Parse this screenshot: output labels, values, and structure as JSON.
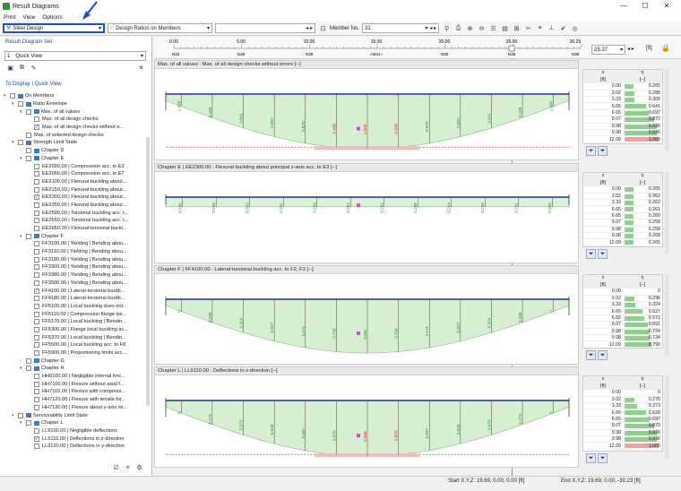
{
  "window": {
    "title": "Result Diagrams"
  },
  "menu": [
    "Print",
    "View",
    "Options"
  ],
  "toolbar": {
    "design_combo": "Steel Design",
    "ratio_combo": "Design Ratios on Members",
    "member_label": "Member No.",
    "member_value": "31"
  },
  "sidebar": {
    "set_title": "Result Diagram Set",
    "set_number": "1",
    "set_name": "Quick View",
    "display_title": "To Display | Quick View",
    "tree": [
      {
        "l": 0,
        "e": "▾",
        "c": "",
        "t": "On Members"
      },
      {
        "l": 1,
        "e": "▾",
        "c": "",
        "t": "Ratio Envelope"
      },
      {
        "l": 2,
        "e": "▾",
        "c": "",
        "t": "Max. of all values"
      },
      {
        "l": 3,
        "e": "",
        "c": "",
        "t": "Max. of all design checks"
      },
      {
        "l": 3,
        "e": "",
        "c": "✓",
        "t": "Max. of all design checks without e..."
      },
      {
        "l": 2,
        "e": "",
        "c": "",
        "t": "Max. of selected design checks"
      },
      {
        "l": 1,
        "e": "▾",
        "c": "",
        "t": "Strength Limit State"
      },
      {
        "l": 2,
        "e": "›",
        "c": "",
        "t": "Chapter D"
      },
      {
        "l": 2,
        "e": "▾",
        "c": "",
        "t": "Chapter E"
      },
      {
        "l": 3,
        "e": "",
        "c": "",
        "t": "EE2000.00 | Compression acc. to E3"
      },
      {
        "l": 3,
        "e": "",
        "c": "",
        "t": "EE2050.00 | Compression acc. to E7"
      },
      {
        "l": 3,
        "e": "",
        "c": "",
        "t": "EE2100.00 | Flexural buckling about..."
      },
      {
        "l": 3,
        "e": "",
        "c": "",
        "t": "EE2150.00 | Flexural buckling about..."
      },
      {
        "l": 3,
        "e": "",
        "c": "✓",
        "t": "EE2300.00 | Flexural buckling about..."
      },
      {
        "l": 3,
        "e": "",
        "c": "",
        "t": "EE2350.00 | Flexural buckling about..."
      },
      {
        "l": 3,
        "e": "",
        "c": "",
        "t": "EE2500.00 | Torsional buckling acc. t..."
      },
      {
        "l": 3,
        "e": "",
        "c": "",
        "t": "EE2550.00 | Torsional buckling acc. t..."
      },
      {
        "l": 3,
        "e": "",
        "c": "",
        "t": "EE2650.00 | Flexural-torsional buckl..."
      },
      {
        "l": 2,
        "e": "▾",
        "c": "",
        "t": "Chapter F"
      },
      {
        "l": 3,
        "e": "",
        "c": "",
        "t": "FF3100.00 | Yielding | Bending abou..."
      },
      {
        "l": 3,
        "e": "",
        "c": "",
        "t": "FF3110.00 | Yielding | Bending abou..."
      },
      {
        "l": 3,
        "e": "",
        "c": "",
        "t": "FF3180.00 | Yielding | Bending abou..."
      },
      {
        "l": 3,
        "e": "",
        "c": "",
        "t": "FF3300.00 | Yielding | Bending abou..."
      },
      {
        "l": 3,
        "e": "",
        "c": "",
        "t": "FF3380.00 | Yielding | Bending abou..."
      },
      {
        "l": 3,
        "e": "",
        "c": "",
        "t": "FF3500.00 | Yielding | Bending abou..."
      },
      {
        "l": 3,
        "e": "",
        "c": "✓",
        "t": "FF4100.00 | Lateral-torsional buckli..."
      },
      {
        "l": 3,
        "e": "",
        "c": "",
        "t": "FF4180.00 | Lateral-torsional buckli..."
      },
      {
        "l": 3,
        "e": "",
        "c": "",
        "t": "FF5100.00 | Local buckling does not..."
      },
      {
        "l": 3,
        "e": "",
        "c": "",
        "t": "FF5110.00 | Compression flange los..."
      },
      {
        "l": 3,
        "e": "",
        "c": "",
        "t": "FF5170.00 | Local buckling | Bendin..."
      },
      {
        "l": 3,
        "e": "",
        "c": "",
        "t": "FF5300.00 | Flange local buckling ac..."
      },
      {
        "l": 3,
        "e": "",
        "c": "",
        "t": "FF5370.00 | Local buckling | Bendin..."
      },
      {
        "l": 3,
        "e": "",
        "c": "",
        "t": "FF5500.00 | Local buckling acc. to F8"
      },
      {
        "l": 3,
        "e": "",
        "c": "",
        "t": "FF5900.00 | Proportioning limits acc..."
      },
      {
        "l": 2,
        "e": "›",
        "c": "",
        "t": "Chapter G"
      },
      {
        "l": 2,
        "e": "▾",
        "c": "",
        "t": "Chapter H"
      },
      {
        "l": 3,
        "e": "",
        "c": "",
        "t": "HH0100.00 | Negligible internal forc..."
      },
      {
        "l": 3,
        "e": "",
        "c": "",
        "t": "HH7100.00 | Flexure without axial f..."
      },
      {
        "l": 3,
        "e": "",
        "c": "",
        "t": "HH7110.00 | Flexure with compress..."
      },
      {
        "l": 3,
        "e": "",
        "c": "",
        "t": "HH7120.00 | Flexure with tensile for..."
      },
      {
        "l": 3,
        "e": "",
        "c": "",
        "t": "HH7130.00 | Flexure about y-axis wi..."
      },
      {
        "l": 1,
        "e": "▾",
        "c": "",
        "t": "Serviceability Limit State"
      },
      {
        "l": 2,
        "e": "▾",
        "c": "",
        "t": "Chapter L"
      },
      {
        "l": 3,
        "e": "",
        "c": "",
        "t": "LL9100.00 | Negligible deflections"
      },
      {
        "l": 3,
        "e": "",
        "c": "✓",
        "t": "LL9110.00 | Deflections in z-direction"
      },
      {
        "l": 3,
        "e": "",
        "c": "",
        "t": "LL9120.00 | Deflections in y-direction"
      }
    ]
  },
  "ruler": {
    "ticks": [
      "0.00",
      "5.00",
      "10.00",
      "15.00",
      "20.00",
      "25.00",
      "30.25"
    ],
    "nodes": [
      "N33",
      "N38",
      "N38",
      "«M31»",
      "N38",
      "N38",
      "N38"
    ],
    "position_value": "25.37",
    "unit": "[ft]"
  },
  "panels": [
    {
      "title": "Max. of all values : Max. of all design checks without errors [--]",
      "labels": [
        "1.000",
        "0.189",
        "0.641",
        "0.697",
        "0.870",
        "0.936",
        "1.000",
        "0.936",
        "0.870",
        "0.697",
        "0.641",
        "0.189",
        "1.000"
      ],
      "table": {
        "col_x": "x",
        "col_eta": "η",
        "unit_x": "[ft]",
        "unit_eta": "[--]",
        "rows": [
          [
            "0.00",
            "0.265",
            0.27
          ],
          [
            "3.02",
            "0.288",
            0.29
          ],
          [
            "3.33",
            "0.300",
            0.3
          ],
          [
            "6.65",
            "0.641",
            0.64
          ],
          [
            "6.65",
            "0.697",
            0.7
          ],
          [
            "9.07",
            "0.870",
            0.87
          ],
          [
            "9.98",
            "0.936",
            0.94
          ],
          [
            "9.98",
            "0.936",
            0.94
          ],
          [
            "12.09",
            "1.000",
            1
          ]
        ]
      }
    },
    {
      "title": "Chapter E | EE2300.00 : Flexural buckling about principal z-axis acc. to E3 [--]",
      "labels": [
        "0.265",
        "0.288",
        "0.300",
        "0.261",
        "0.260",
        "0.264",
        "0.262",
        "0.268",
        "0.264",
        "0.260",
        "0.261",
        "0.285"
      ],
      "table": {
        "col_x": "x",
        "col_eta": "η",
        "unit_x": "[ft]",
        "unit_eta": "[--]",
        "rows": [
          [
            "0.00",
            "0.265",
            0.27
          ],
          [
            "3.02",
            "0.262",
            0.26
          ],
          [
            "3.33",
            "0.262",
            0.26
          ],
          [
            "6.65",
            "0.261",
            0.26
          ],
          [
            "6.65",
            "0.260",
            0.26
          ],
          [
            "9.07",
            "0.258",
            0.26
          ],
          [
            "9.98",
            "0.258",
            0.26
          ],
          [
            "9.98",
            "0.268",
            0.27
          ],
          [
            "12.09",
            "0.265",
            0.27
          ]
        ]
      }
    },
    {
      "title": "Chapter F | FF4100.00 : Lateral-torsional buckling acc. to F2, F3 [--]",
      "labels": [
        "0",
        "0.296",
        "0.324",
        "0.527",
        "0.571",
        "0.734",
        "0.691",
        "0.734",
        "0.571",
        "0.527",
        "0.324",
        "0.296",
        "0"
      ],
      "table": {
        "col_x": "x",
        "col_eta": "η",
        "unit_x": "[ft]",
        "unit_eta": "[--]",
        "rows": [
          [
            "0.00",
            "0",
            0
          ],
          [
            "3.02",
            "0.296",
            0.3
          ],
          [
            "3.33",
            "0.324",
            0.32
          ],
          [
            "6.65",
            "0.527",
            0.53
          ],
          [
            "6.65",
            "0.571",
            0.57
          ],
          [
            "9.07",
            "0.691",
            0.69
          ],
          [
            "9.98",
            "0.734",
            0.73
          ],
          [
            "9.98",
            "0.734",
            0.73
          ],
          [
            "12.09",
            "0.790",
            0.79
          ]
        ]
      }
    },
    {
      "title": "Chapter L | LL9110.00 : Deflections in z-direction [--]",
      "labels": [
        "0",
        "0.275",
        "0.373",
        "0.628",
        "0.697",
        "0.870",
        "0.936",
        "0.870",
        "0.697",
        "0.628",
        "0.373",
        "0.275",
        "0"
      ],
      "table": {
        "col_x": "x",
        "col_eta": "η",
        "unit_x": "[ft]",
        "unit_eta": "[--]",
        "rows": [
          [
            "0.00",
            "0",
            0
          ],
          [
            "3.02",
            "0.275",
            0.28
          ],
          [
            "3.33",
            "0.373",
            0.37
          ],
          [
            "6.65",
            "0.628",
            0.63
          ],
          [
            "6.65",
            "0.697",
            0.7
          ],
          [
            "9.07",
            "0.870",
            0.87
          ],
          [
            "9.98",
            "0.936",
            0.94
          ],
          [
            "9.98",
            "0.936",
            0.94
          ],
          [
            "12.09",
            "1.000",
            1
          ]
        ]
      }
    }
  ],
  "status": {
    "start": "Start X,Y,Z: 19.69, 0.00, 0.00 [ft]",
    "end": "End X,Y,Z: 19.69, 0.00, -30.23 [ft]"
  },
  "colors": {
    "accent": "#1d4fd6",
    "fill": "#cdebc8",
    "exceed": "#f4b9b9",
    "beam": "#1c2fa8"
  }
}
